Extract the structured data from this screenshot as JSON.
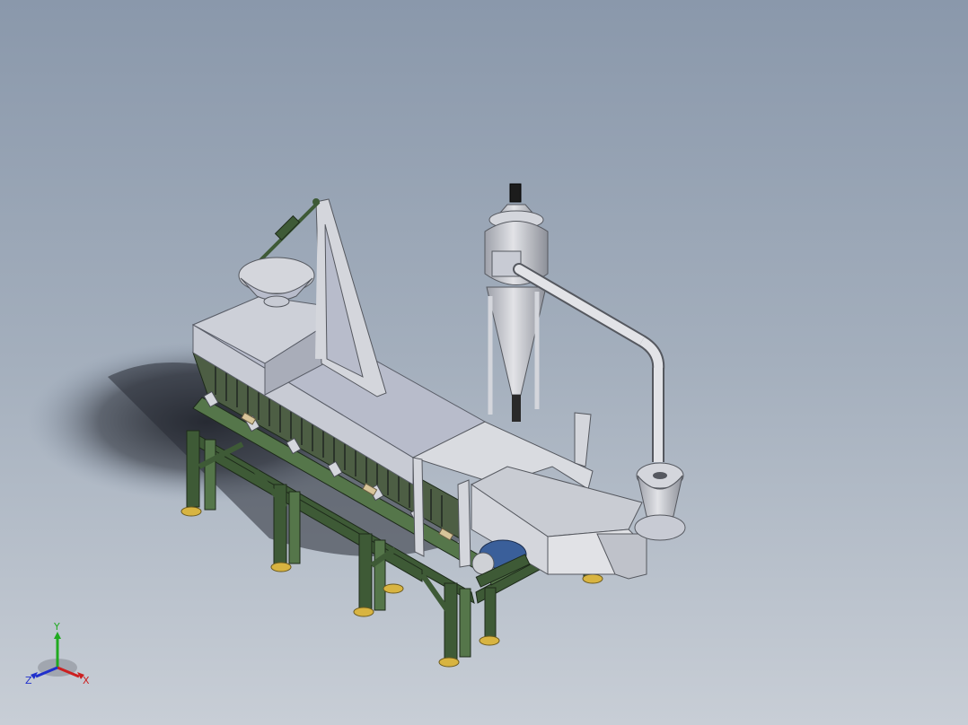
{
  "view": {
    "background_top": "#8a98ab",
    "background_bottom": "#c8ced6"
  },
  "model": {
    "colors": {
      "frame": "#3e5a36",
      "frame_light": "#55764a",
      "sheet_metal": "#d4d6dc",
      "sheet_metal_dark": "#9c9fa8",
      "hood_top": "#b8bccb",
      "motor": "#3a5f9a",
      "feet": "#d8b441",
      "shadow": "#1c1f26"
    }
  },
  "triad": {
    "x_label": "X",
    "y_label": "Y",
    "z_label": "Z",
    "x_color": "#cc2020",
    "y_color": "#20aa20",
    "z_color": "#2030cc"
  }
}
